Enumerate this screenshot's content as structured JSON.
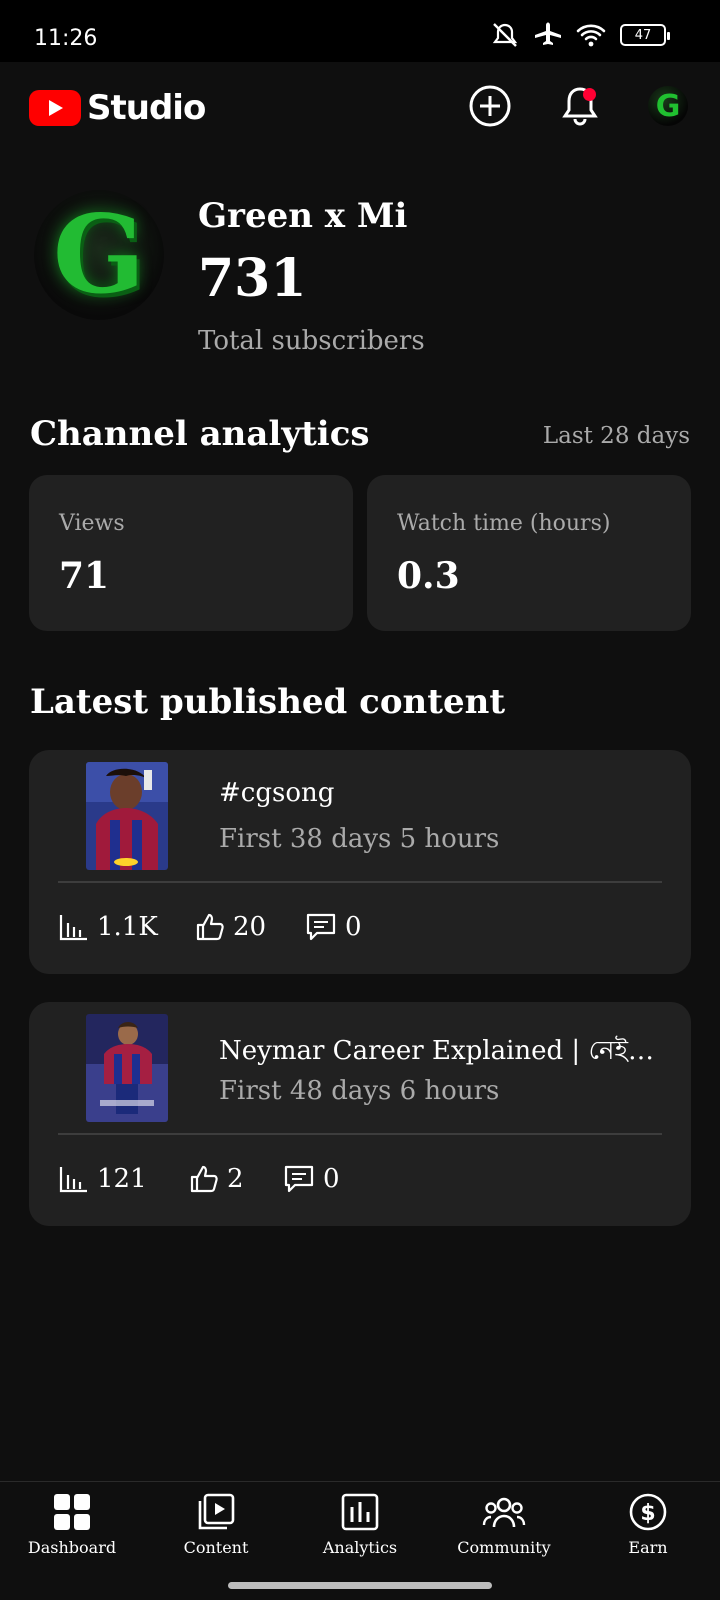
{
  "status_bar": {
    "time": "11:26",
    "battery": "47",
    "icons": [
      "mute-icon",
      "airplane-icon",
      "wifi-icon",
      "battery-icon"
    ]
  },
  "app_bar": {
    "logo_text": "Studio",
    "actions": [
      "create-icon",
      "bell-icon",
      "avatar"
    ]
  },
  "channel": {
    "avatar_letter": "G",
    "name": "Green x Mi",
    "subscribers": "731",
    "subscribers_label": "Total subscribers"
  },
  "analytics": {
    "title": "Channel analytics",
    "range": "Last 28 days",
    "cards": [
      {
        "label": "Views",
        "value": "71"
      },
      {
        "label": "Watch time (hours)",
        "value": "0.3"
      }
    ]
  },
  "latest": {
    "title": "Latest published content",
    "items": [
      {
        "title": "#cgsong",
        "subtitle": "First 38 days 5 hours",
        "views": "1.1K",
        "likes": "20",
        "comments": "0"
      },
      {
        "title": "Neymar Career Explained | নেইমা...",
        "subtitle": "First 48 days 6 hours",
        "views": "121",
        "likes": "2",
        "comments": "0"
      }
    ]
  },
  "bottom_nav": [
    {
      "label": "Dashboard",
      "icon": "dashboard-icon"
    },
    {
      "label": "Content",
      "icon": "content-icon"
    },
    {
      "label": "Analytics",
      "icon": "analytics-icon"
    },
    {
      "label": "Community",
      "icon": "community-icon"
    },
    {
      "label": "Earn",
      "icon": "earn-icon"
    }
  ],
  "colors": {
    "accent": "#ff0000",
    "background": "#0f0f0f",
    "card": "#212121",
    "notification": "#ff0033",
    "avatar_green": "#22bb33"
  }
}
